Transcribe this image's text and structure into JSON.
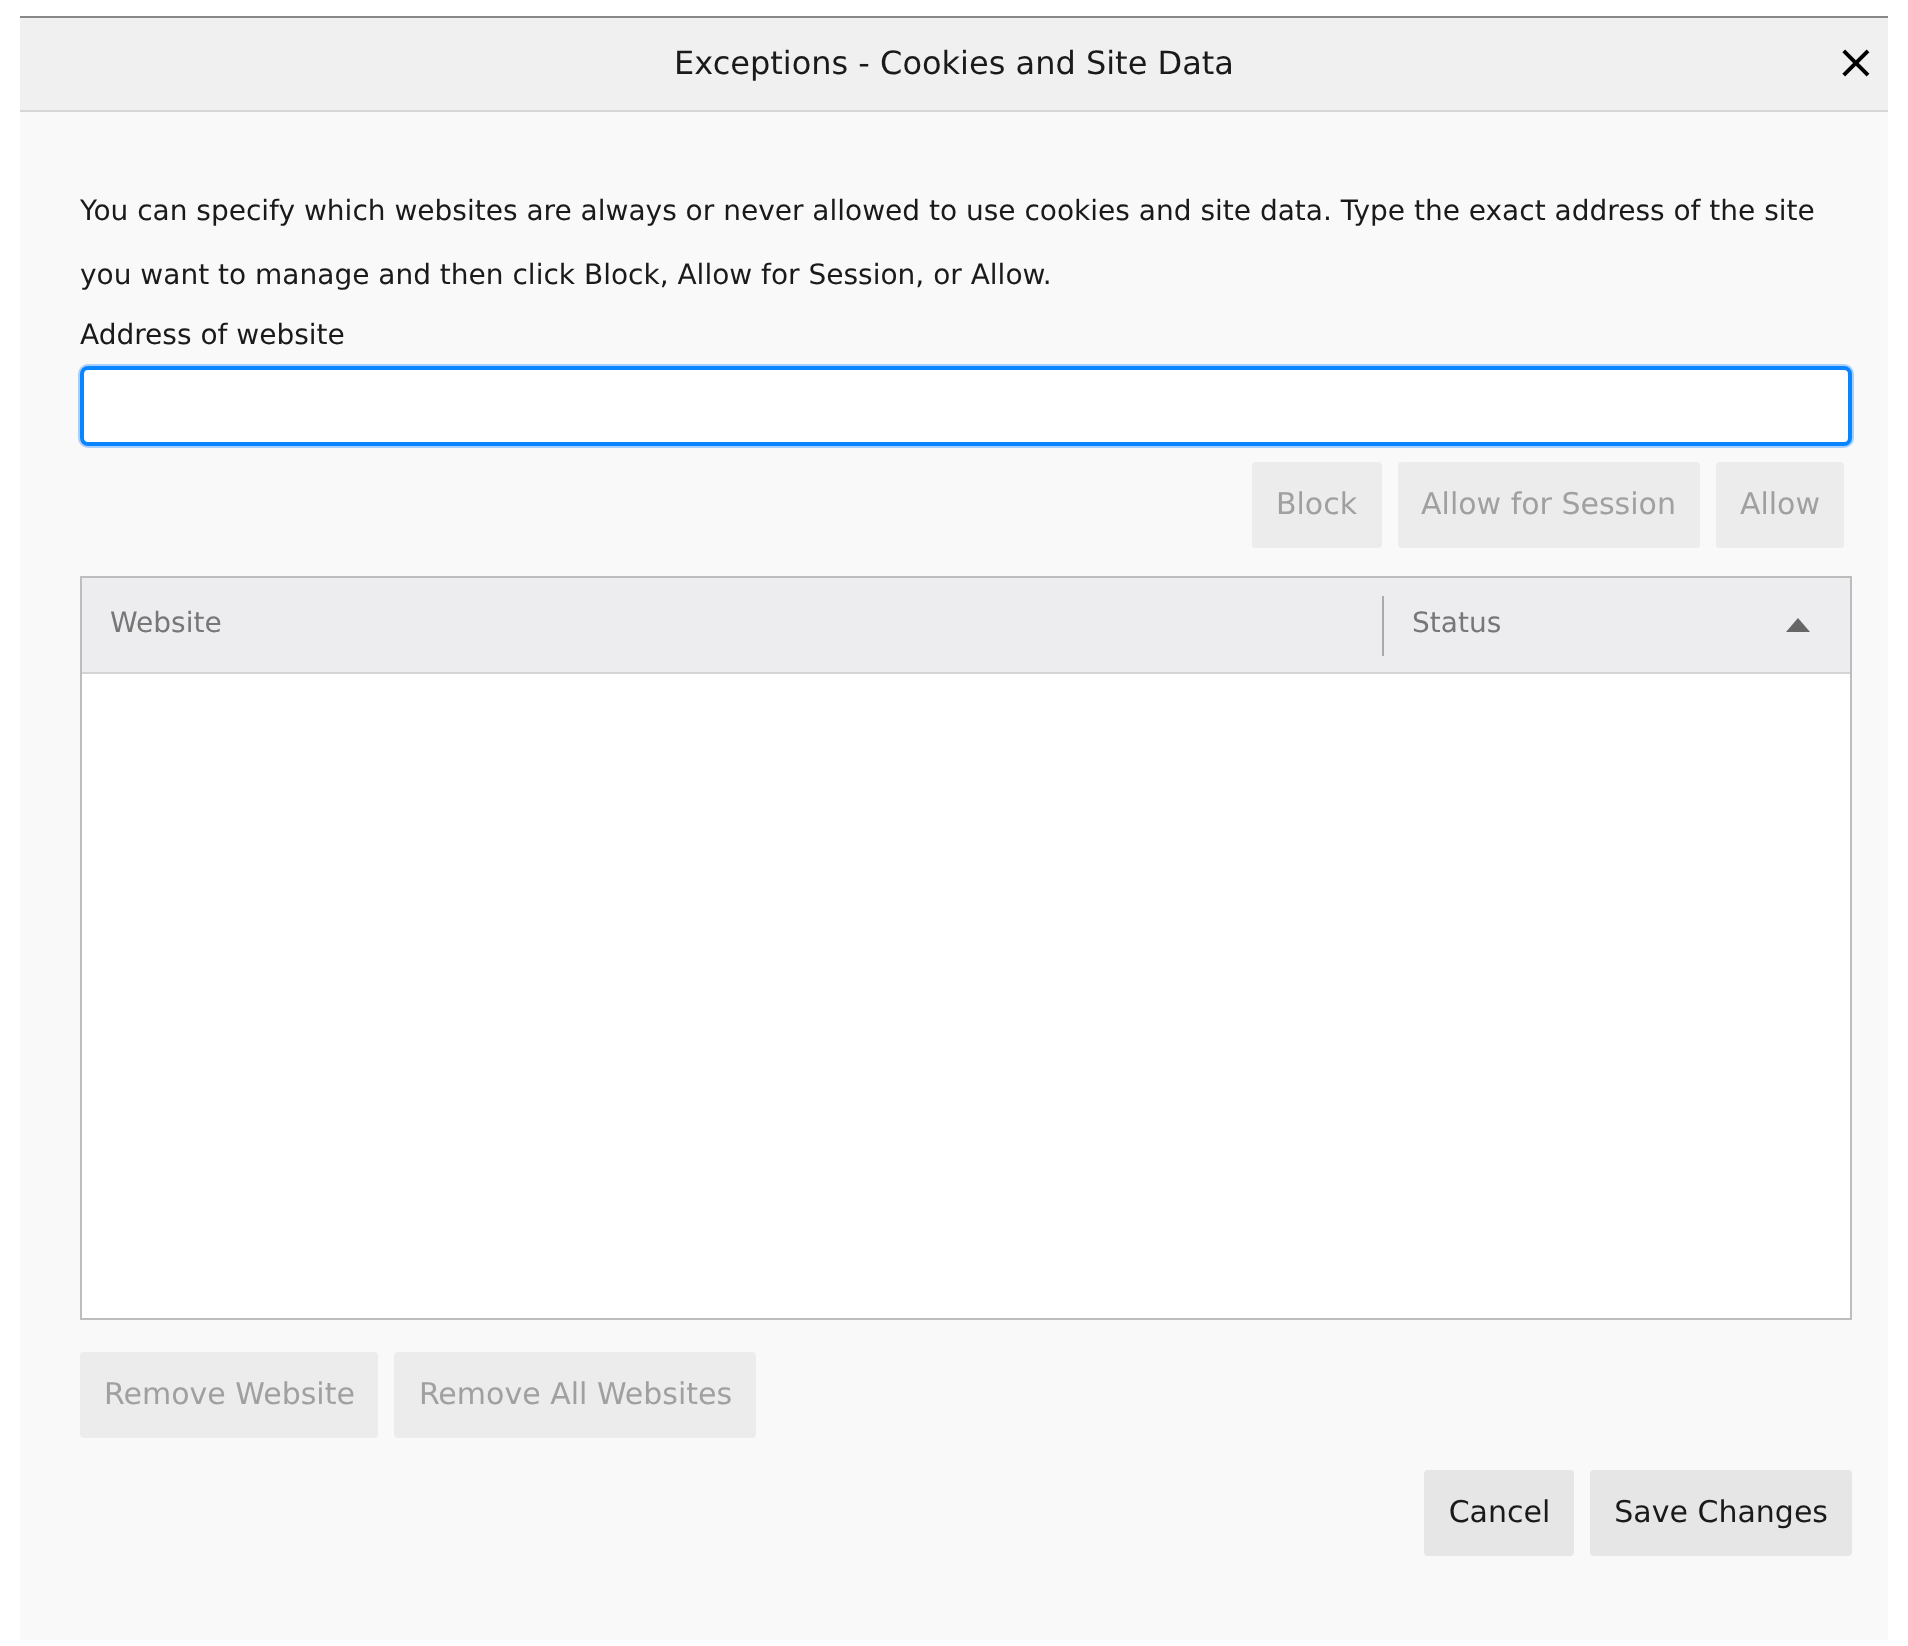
{
  "window": {
    "title": "Exceptions - Cookies and Site Data",
    "close": "×"
  },
  "description": "You can specify which websites are always or never allowed to use cookies and site data. Type the exact address of the site you want to manage and then click Block, Allow for Session, or Allow.",
  "address_field": {
    "label": "Address of website",
    "focused": true
  },
  "action_buttons": [
    {
      "label": "Block",
      "disabled": true
    },
    {
      "label": "Allow for Session",
      "disabled": true
    },
    {
      "label": "Allow",
      "disabled": true
    }
  ],
  "table": {
    "columns": [
      {
        "label": "Website",
        "sorted": false
      },
      {
        "label": "Status",
        "sorted": true
      }
    ]
  },
  "remove_buttons": [
    {
      "label": "Remove Website",
      "disabled": true
    },
    {
      "label": "Remove All Websites",
      "disabled": true
    }
  ],
  "footer_buttons": [
    {
      "label": "Cancel",
      "disabled": false
    },
    {
      "label": "Save Changes",
      "disabled": false
    }
  ]
}
